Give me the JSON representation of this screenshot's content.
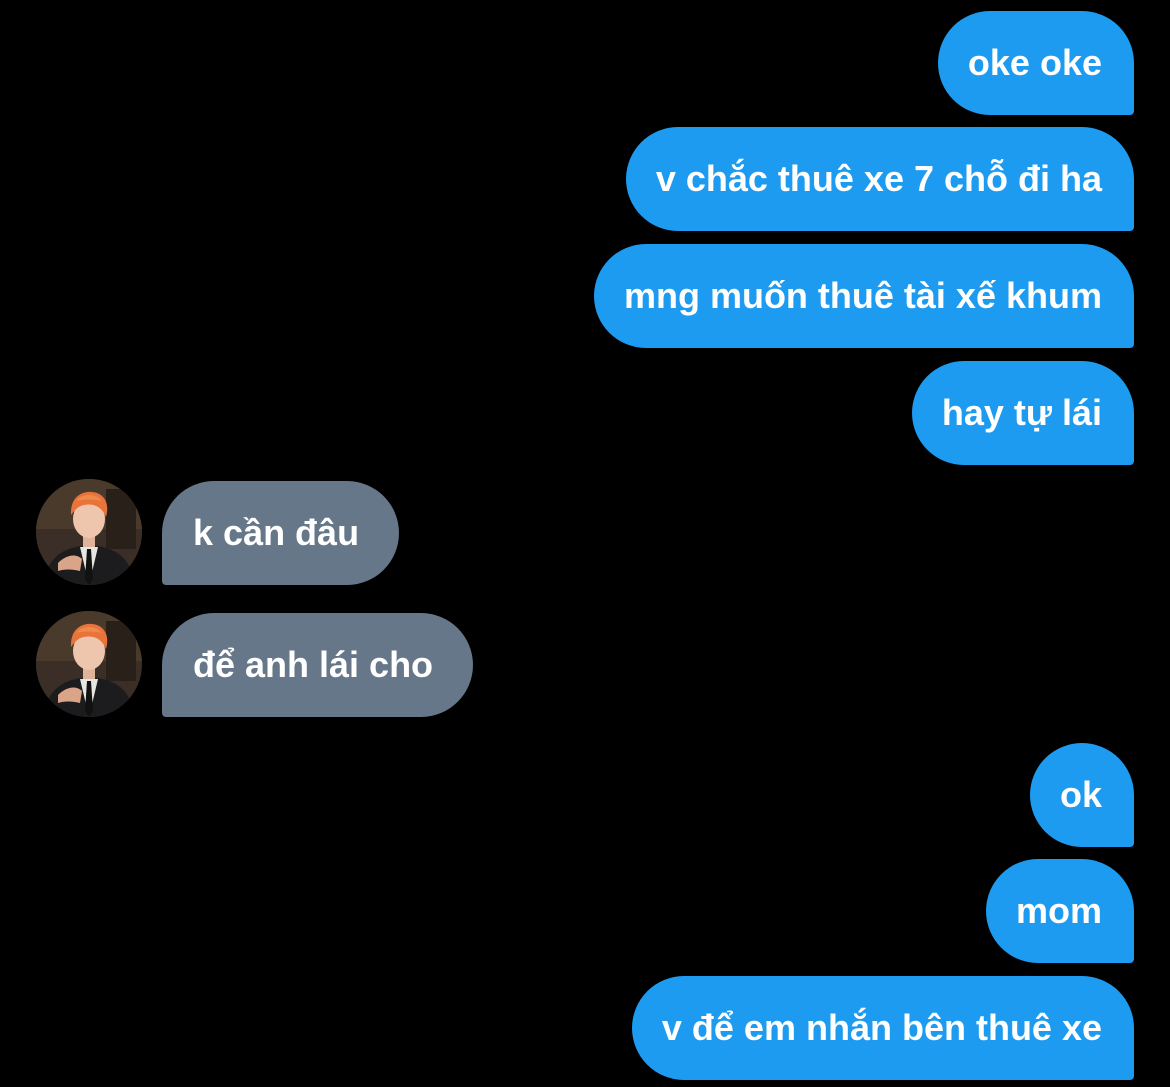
{
  "chat": {
    "messages": [
      {
        "sender": "me",
        "text": "oke oke"
      },
      {
        "sender": "me",
        "text": "v chắc thuê xe 7 chỗ đi ha"
      },
      {
        "sender": "me",
        "text": "mng muốn thuê tài xế khum"
      },
      {
        "sender": "me",
        "text": "hay tự lái"
      },
      {
        "sender": "other",
        "text": "k cần đâu"
      },
      {
        "sender": "other",
        "text": "để anh lái cho"
      },
      {
        "sender": "me",
        "text": "ok"
      },
      {
        "sender": "me",
        "text": "mom"
      },
      {
        "sender": "me",
        "text": "v để em nhắn bên thuê xe"
      }
    ]
  },
  "colors": {
    "background": "#000000",
    "outgoing_bubble": "#1d9bf0",
    "incoming_bubble": "#66778a",
    "text": "#ffffff"
  },
  "icons": {
    "avatar": "user-photo-avatar"
  }
}
